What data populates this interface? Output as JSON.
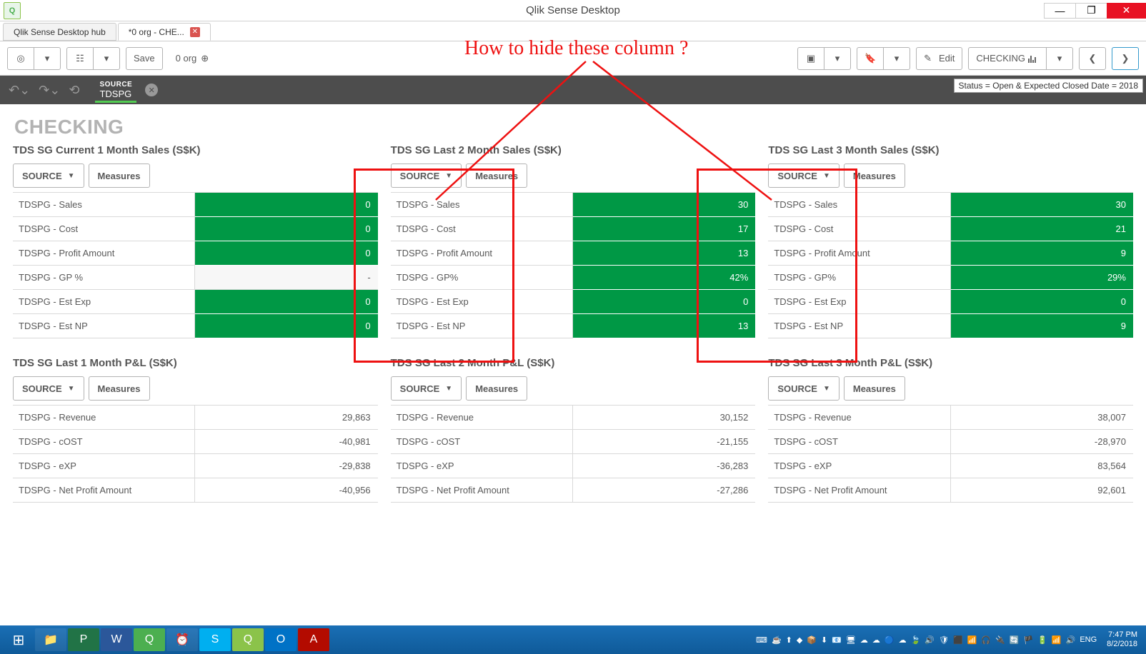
{
  "window": {
    "title": "Qlik Sense Desktop"
  },
  "tabs": [
    {
      "label": "Qlik Sense Desktop hub",
      "closable": false
    },
    {
      "label": "*0 org - CHE...",
      "closable": true
    }
  ],
  "toolbar": {
    "save": "Save",
    "breadcrumb": "0 org",
    "edit": "Edit",
    "sheet_name": "CHECKING"
  },
  "selection": {
    "field": "SOURCE",
    "value": "TDSPG",
    "status_text": "Status = Open & Expected Closed Date = 2018"
  },
  "sheet_title": "CHECKING",
  "annotation_text": "How to hide these column ?",
  "panels_top": [
    {
      "title": "TDS SG Current 1 Month Sales (S$K)",
      "source_btn": "SOURCE",
      "measures_btn": "Measures",
      "rows": [
        {
          "label": "TDSPG - Sales",
          "value": "0",
          "green": true
        },
        {
          "label": "TDSPG - Cost",
          "value": "0",
          "green": true
        },
        {
          "label": "TDSPG - Profit Amount",
          "value": "0",
          "green": true
        },
        {
          "label": "TDSPG - GP %",
          "value": "-",
          "green": false
        },
        {
          "label": "TDSPG - Est Exp",
          "value": "0",
          "green": true
        },
        {
          "label": "TDSPG - Est NP",
          "value": "0",
          "green": true
        }
      ]
    },
    {
      "title": "TDS SG Last 2 Month Sales (S$K)",
      "source_btn": "SOURCE",
      "measures_btn": "Measures",
      "rows": [
        {
          "label": "TDSPG - Sales",
          "value": "30",
          "green": true
        },
        {
          "label": "TDSPG - Cost",
          "value": "17",
          "green": true
        },
        {
          "label": "TDSPG - Profit Amount",
          "value": "13",
          "green": true
        },
        {
          "label": "TDSPG - GP%",
          "value": "42%",
          "green": true
        },
        {
          "label": "TDSPG - Est Exp",
          "value": "0",
          "green": true
        },
        {
          "label": "TDSPG - Est NP",
          "value": "13",
          "green": true
        }
      ]
    },
    {
      "title": "TDS SG Last 3 Month Sales (S$K)",
      "source_btn": "SOURCE",
      "measures_btn": "Measures",
      "rows": [
        {
          "label": "TDSPG - Sales",
          "value": "30",
          "green": true
        },
        {
          "label": "TDSPG - Cost",
          "value": "21",
          "green": true
        },
        {
          "label": "TDSPG - Profit Amount",
          "value": "9",
          "green": true
        },
        {
          "label": "TDSPG - GP%",
          "value": "29%",
          "green": true
        },
        {
          "label": "TDSPG - Est Exp",
          "value": "0",
          "green": true
        },
        {
          "label": "TDSPG - Est NP",
          "value": "9",
          "green": true
        }
      ]
    }
  ],
  "panels_bottom": [
    {
      "title": "TDS SG Last 1 Month P&L (S$K)",
      "source_btn": "SOURCE",
      "measures_btn": "Measures",
      "rows": [
        {
          "label": "TDSPG - Revenue",
          "value": "29,863"
        },
        {
          "label": "TDSPG - cOST",
          "value": "-40,981"
        },
        {
          "label": "TDSPG - eXP",
          "value": "-29,838"
        },
        {
          "label": "TDSPG - Net Profit Amount",
          "value": "-40,956"
        }
      ]
    },
    {
      "title": "TDS SG Last 2 Month P&L (S$K)",
      "source_btn": "SOURCE",
      "measures_btn": "Measures",
      "rows": [
        {
          "label": "TDSPG - Revenue",
          "value": "30,152"
        },
        {
          "label": "TDSPG - cOST",
          "value": "-21,155"
        },
        {
          "label": "TDSPG - eXP",
          "value": "-36,283"
        },
        {
          "label": "TDSPG - Net Profit Amount",
          "value": "-27,286"
        }
      ]
    },
    {
      "title": "TDS SG Last 3 Month P&L (S$K)",
      "source_btn": "SOURCE",
      "measures_btn": "Measures",
      "rows": [
        {
          "label": "TDSPG - Revenue",
          "value": "38,007"
        },
        {
          "label": "TDSPG - cOST",
          "value": "-28,970"
        },
        {
          "label": "TDSPG - eXP",
          "value": "83,564"
        },
        {
          "label": "TDSPG - Net Profit Amount",
          "value": "92,601"
        }
      ]
    }
  ],
  "taskbar": {
    "lang": "ENG",
    "time": "7:47 PM",
    "date": "8/2/2018"
  }
}
